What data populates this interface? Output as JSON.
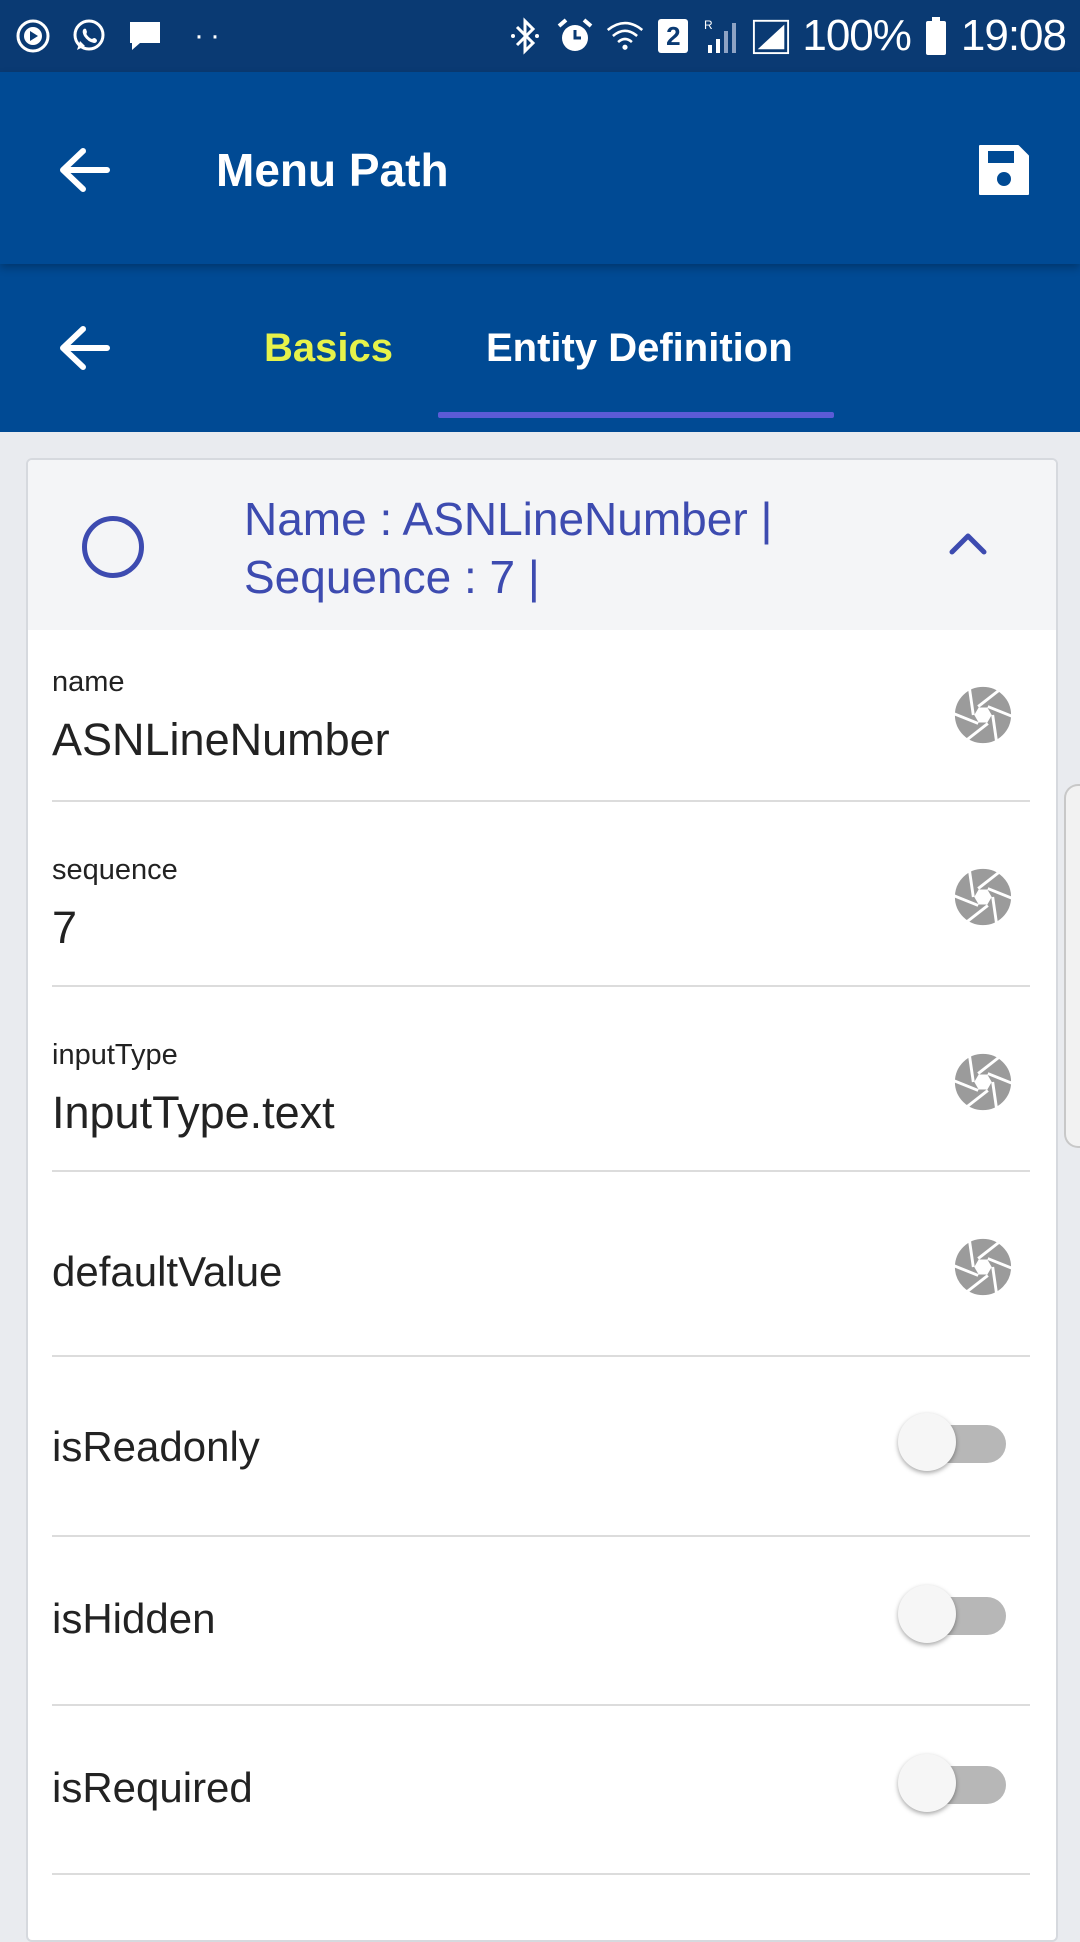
{
  "status_bar": {
    "battery": "100%",
    "time": "19:08",
    "sim_number": "2",
    "dots": "··"
  },
  "app_bar": {
    "title": "Menu Path"
  },
  "tabs": [
    {
      "label": "Basics",
      "color": "#e6f24a"
    },
    {
      "label": "Entity Definition",
      "color": "#ffffff",
      "active": true
    }
  ],
  "card": {
    "header_line1": "Name : ASNLineNumber |",
    "header_line2": "Sequence : 7 |"
  },
  "fields": [
    {
      "label": "name",
      "value": "ASNLineNumber"
    },
    {
      "label": "sequence",
      "value": "7"
    },
    {
      "label": "inputType",
      "value": "InputType.text"
    },
    {
      "label": "defaultValue",
      "value": ""
    }
  ],
  "toggles": [
    {
      "label": "isReadonly",
      "on": false
    },
    {
      "label": "isHidden",
      "on": false
    },
    {
      "label": "isRequired",
      "on": false
    }
  ],
  "colors": {
    "app_bar": "#004a94",
    "status_bar": "#0a3a73",
    "accent": "#3d4bb0",
    "tab_indicator": "#5b5bd6"
  }
}
